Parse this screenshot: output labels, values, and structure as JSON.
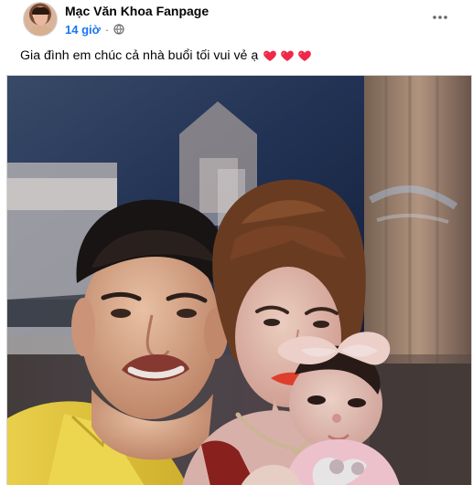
{
  "post": {
    "page_name": "Mạc Văn Khoa Fanpage",
    "time": "14 giờ",
    "separator": "·",
    "caption": "Gia đình em chúc cả nhà buổi tối vui vẻ ạ",
    "caption_hearts": [
      "heart-icon",
      "heart-icon",
      "heart-icon"
    ],
    "privacy_icon": "globe-icon",
    "more_icon": "more-horizontal-icon"
  },
  "colors": {
    "link_blue": "#1877f2",
    "text_primary": "#050505",
    "text_secondary": "#65676b",
    "heart_red": "#f02849"
  }
}
